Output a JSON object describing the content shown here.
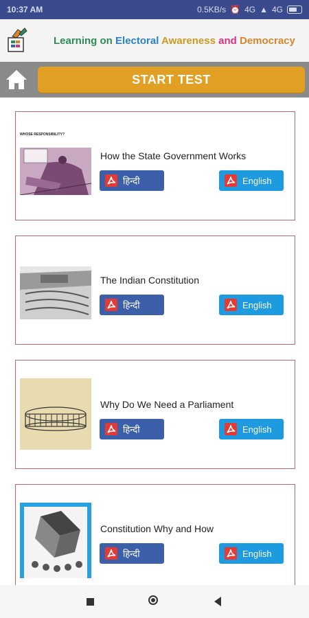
{
  "status_bar": {
    "time": "10:37 AM",
    "speed": "0.5KB/s",
    "network_1": "4G",
    "network_2": "4G",
    "battery_icon": "battery-icon"
  },
  "header": {
    "title_words": [
      "Learning",
      "on",
      "Electoral",
      "Awareness",
      "and",
      "Democracy"
    ],
    "logo_icon": "eci-logo-icon"
  },
  "toolbar": {
    "home_icon": "home-icon",
    "start_label": "START TEST"
  },
  "cards": [
    {
      "title": "How the State Government Works",
      "hindi_label": "हिन्दी",
      "english_label": "English",
      "thumb_caption": "WHOSE RESPONSIBILITY?"
    },
    {
      "title": "The Indian Constitution",
      "hindi_label": "हिन्दी",
      "english_label": "English"
    },
    {
      "title": "Why Do We Need a Parliament",
      "hindi_label": "हिन्दी",
      "english_label": "English"
    },
    {
      "title": "Constitution Why and How",
      "hindi_label": "हिन्दी",
      "english_label": "English"
    }
  ],
  "colors": {
    "status_bar": "#3a4a8c",
    "start_button": "#e1a023",
    "hindi_button": "#3b5fa8",
    "english_button": "#1e9be0",
    "card_border": "#b06a6a"
  },
  "nav": {
    "recents_icon": "square-icon",
    "home_icon": "circle-icon",
    "back_icon": "triangle-back-icon"
  }
}
